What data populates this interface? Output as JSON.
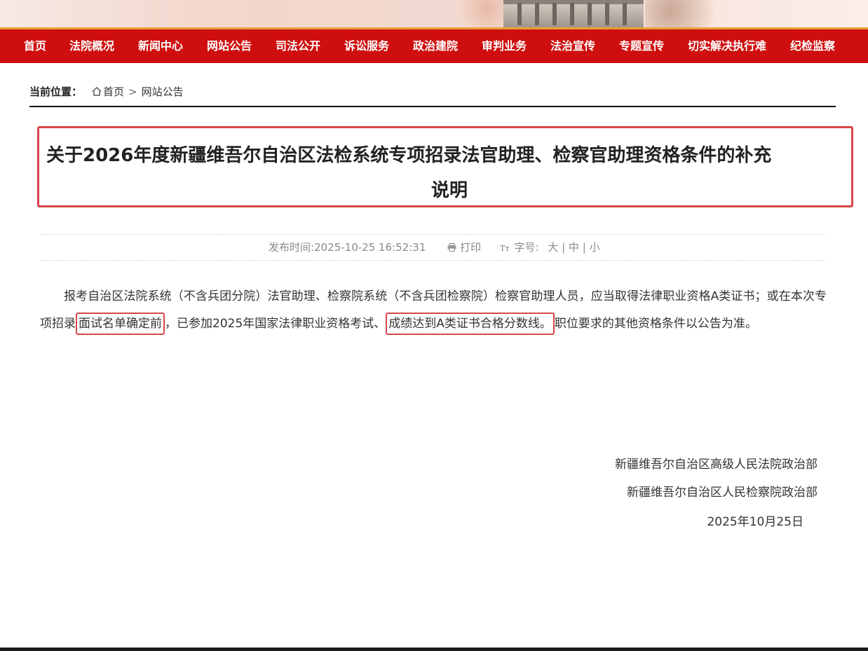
{
  "nav": {
    "items": [
      "首页",
      "法院概况",
      "新闻中心",
      "网站公告",
      "司法公开",
      "诉讼服务",
      "政治建院",
      "审判业务",
      "法治宣传",
      "专题宣传",
      "切实解决执行难",
      "纪检监察"
    ]
  },
  "breadcrumb": {
    "label": "当前位置：",
    "home": "首页",
    "separator": ">",
    "current": "网站公告"
  },
  "article": {
    "title_line1": "关于2026年度新疆维吾尔自治区法检系统专项招录法官助理、检察官助理资格条件的补充",
    "title_line2": "说明",
    "meta": {
      "publish_label": "发布时间:",
      "publish_time": "2025-10-25 16:52:31",
      "print_label": "打印",
      "font_size_label": "字号:",
      "size_large": "大",
      "size_medium": "中",
      "size_small": "小",
      "size_sep": "|"
    },
    "body": {
      "part1": "报考自治区法院系统（不含兵团分院）法官助理、检察院系统（不含兵团检察院）检察官助理人员，应当取得法律职业资格A类证书；或在本次专项招录",
      "highlight1": "面试名单确定前",
      "part2": "，已参加2025年国家法律职业资格考试、",
      "highlight2": "成绩达到A类证书合格分数线。",
      "part3": "职位要求的其他资格条件以公告为准。"
    },
    "signature": {
      "org1": "新疆维吾尔自治区高级人民法院政治部",
      "org2": "新疆维吾尔自治区人民检察院政治部",
      "date": "2025年10月25日"
    }
  },
  "colors": {
    "nav_bg": "#cf0f0f",
    "highlight_border": "#d9464a",
    "accent_gold": "#e6a23c"
  }
}
